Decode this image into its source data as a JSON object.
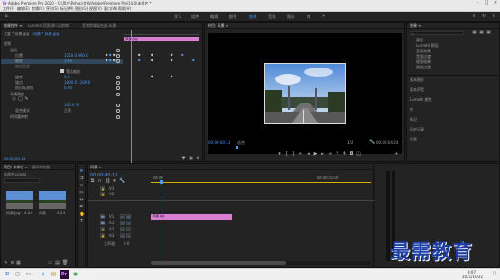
{
  "app": {
    "title": "Adobe Premiere Pro 2020 - C:\\用户\\Pshop\\文档\\Adobe\\Premiere Pro\\14.0\\未命名 *",
    "menu": [
      "文件(F)",
      "编辑(E)",
      "剪辑(C)",
      "序列(S)",
      "标记(M)",
      "图形(G)",
      "视图(V)",
      "窗口(W)",
      "帮助(H)"
    ],
    "workspaces": [
      "学习",
      "组件",
      "编辑",
      "颜色",
      "效果",
      "音频",
      "图形",
      "库"
    ],
    "active_workspace": "效果"
  },
  "effect_controls": {
    "tabs": [
      "效果控件 ≡",
      "Lumetri 范围",
      "源:(无剪辑)",
      "音频剪辑混合器:风景"
    ],
    "source": "主要 * 风景.jpg",
    "clip": "风景 * 风景.jpg",
    "clip_bar_label": "风景.jpg",
    "section_video": "视频",
    "fx_motion": "运动",
    "position_label": "位置",
    "position_values": "1250.0  890.0",
    "scale_label": "缩放",
    "scale_value": "33.0",
    "scale_width_label": "缩放宽度",
    "uniform_scale": "等比缩放",
    "rotation_label": "旋转",
    "rotation_value": "0.0",
    "anchor_label": "锚点",
    "anchor_values": "1800.0  1200.0",
    "antiflicker_label": "防闪烁滤镜",
    "antiflicker_value": "0.00",
    "opacity_label": "不透明度",
    "opacity_value": "100.0 %",
    "blend_label": "混合模式",
    "blend_value": "正常",
    "time_remap": "时间重映射",
    "timecode": "00:00:00:13"
  },
  "program": {
    "tab": "节目: 风景 ≡",
    "timecode": "00:00:00:13",
    "fit": "适合",
    "ratio": "1/2",
    "duration": "00:00:04:24"
  },
  "effects_panel": {
    "tab": "效果 ≡",
    "items": [
      "预设",
      "Lumetri 预设",
      "音频效果",
      "音频过渡",
      "视频效果",
      "视频过渡"
    ],
    "sections": [
      "基本图形",
      "基本声音",
      "Lumetri 颜色",
      "库",
      "标记",
      "历史记录",
      "信息"
    ]
  },
  "project": {
    "tabs": [
      "项目: 未命名 ≡",
      "媒体浏览器"
    ],
    "file": "未命名.prproj",
    "thumbs": [
      {
        "name": "风景.jpg",
        "dur": "4:24"
      },
      {
        "name": "风景",
        "dur": "4:24"
      }
    ]
  },
  "timeline": {
    "tab": "风景 ≡",
    "timecode": "00:00:00:13",
    "ruler": [
      "00:00",
      "00:00:05:00"
    ],
    "video_tracks": [
      "V3",
      "V2",
      "V1"
    ],
    "audio_tracks": [
      "A1",
      "A2",
      "A3"
    ],
    "master_label": "主声道",
    "master_value": "0.0",
    "clip_label": "风景.jpg"
  },
  "watermark": "最需教育",
  "taskbar": {
    "time": "9:07",
    "date": "2021/10/22"
  }
}
